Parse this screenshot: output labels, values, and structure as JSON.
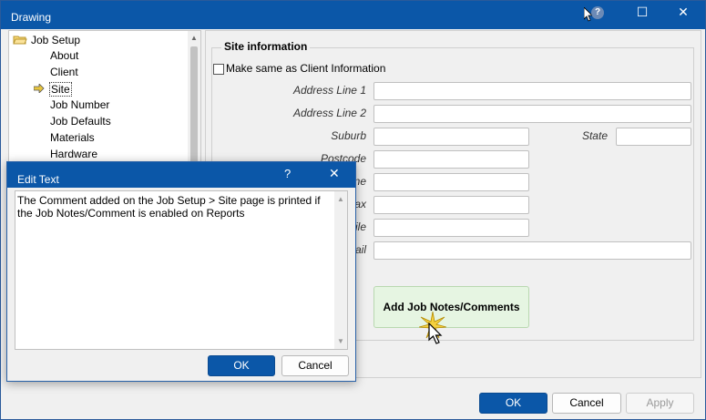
{
  "window": {
    "title": "Drawing",
    "help_glyph": "?",
    "maximize_glyph": "☐",
    "close_glyph": "✕"
  },
  "tree": {
    "root": "Job Setup",
    "items": [
      "About",
      "Client",
      "Site",
      "Job Number",
      "Job Defaults",
      "Materials",
      "Hardware"
    ],
    "selected": "Site",
    "scroll_up": "▲"
  },
  "site": {
    "legend": "Site information",
    "same_as_client": "Make same as Client Information",
    "address1_label": "Address Line 1",
    "address2_label": "Address Line 2",
    "suburb_label": "Suburb",
    "state_label": "State",
    "postcode_label": "Postcode",
    "phone_label_partial": "ne",
    "fax_label_partial": "ax",
    "mobile_label_partial": "ile",
    "email_label_partial": "ail",
    "notes_button": "Add Job Notes/Comments"
  },
  "edit_dialog": {
    "title": "Edit Text",
    "help": "?",
    "close": "✕",
    "text": "The Comment added on the Job Setup > Site page is printed if the Job Notes/Comment is enabled on Reports",
    "ok": "OK",
    "cancel": "Cancel",
    "scroll_up": "▲",
    "scroll_down": "▼"
  },
  "footer": {
    "ok": "OK",
    "cancel": "Cancel",
    "apply": "Apply"
  },
  "colors": {
    "titlebar": "#0b57a8",
    "notes_button_bg": "#e6f5e2"
  }
}
